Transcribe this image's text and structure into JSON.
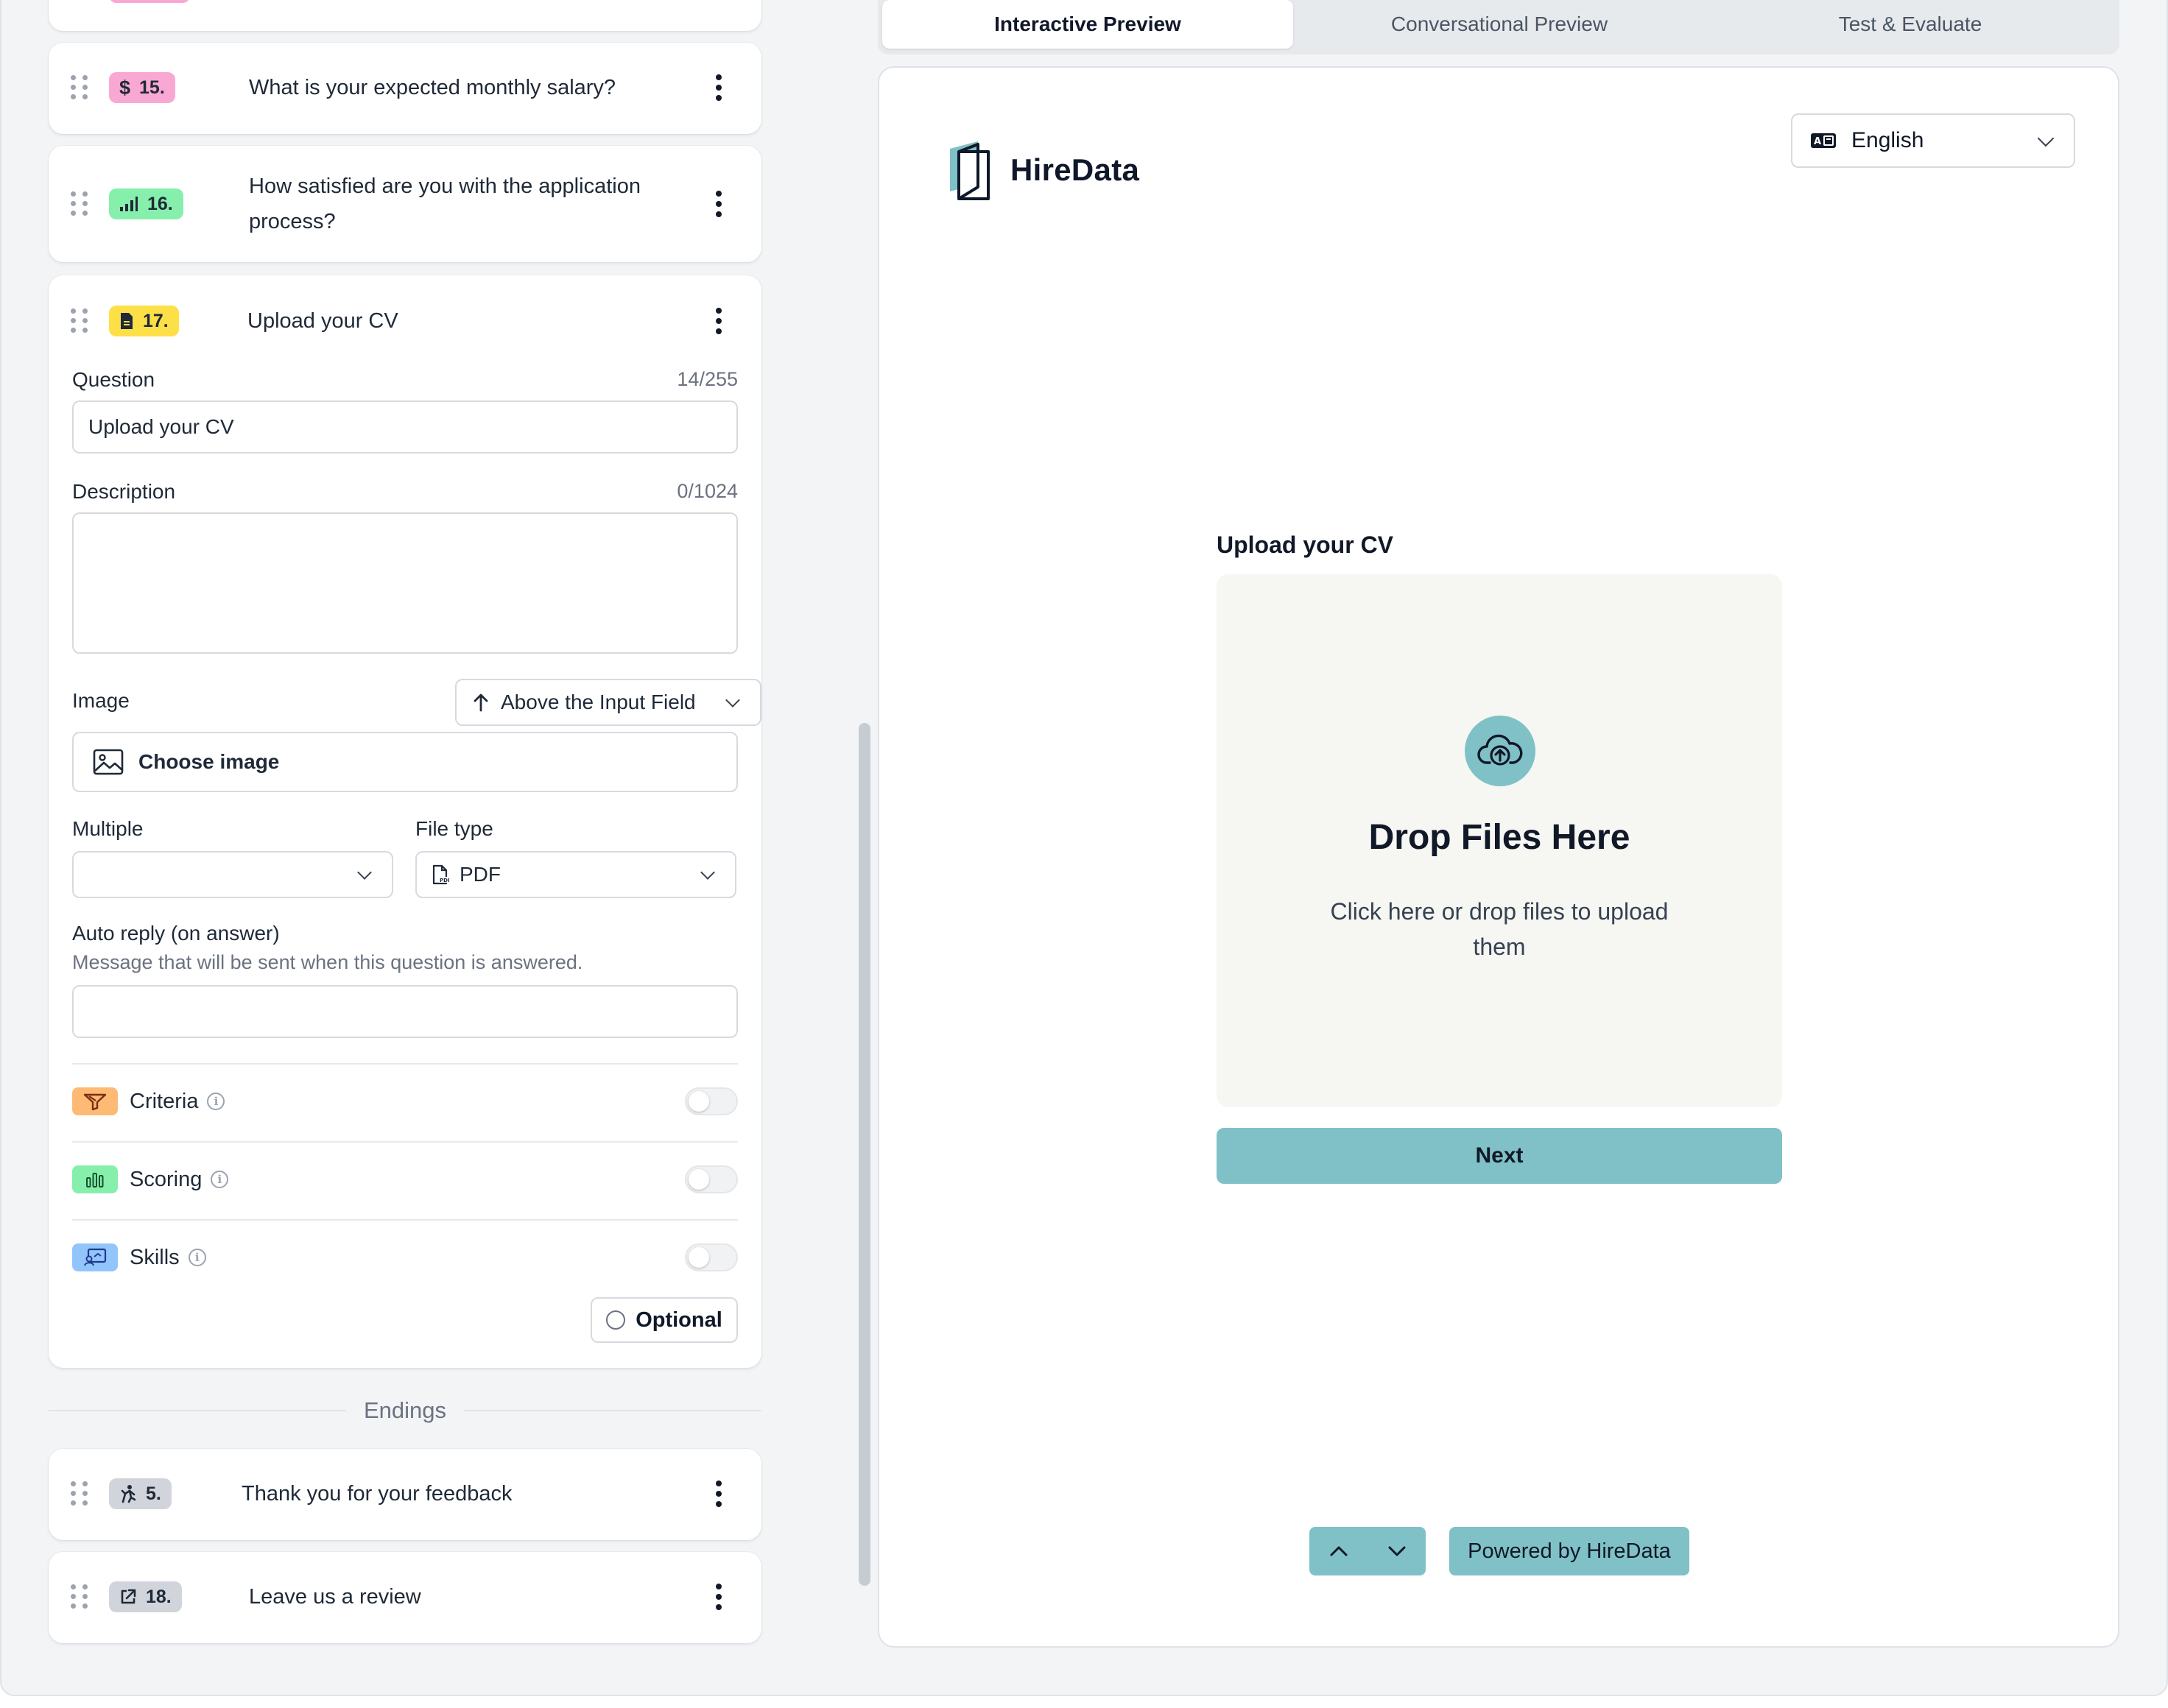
{
  "questions_above": [
    {
      "number": "15.",
      "text": "What is your expected monthly salary?",
      "badge_color": "#f9a8d4",
      "icon": "dollar-icon"
    },
    {
      "number": "16.",
      "text": "How satisfied are you with the application process?",
      "badge_color": "#86efac",
      "icon": "signal-bars-icon"
    }
  ],
  "active_question": {
    "number": "17.",
    "title": "Upload your CV",
    "badge_color": "#fde047",
    "icon": "file-icon",
    "question_label": "Question",
    "question_counter": "14/255",
    "question_value": "Upload your CV",
    "description_label": "Description",
    "description_counter": "0/1024",
    "description_value": "",
    "image_label": "Image",
    "image_position": "Above the Input Field",
    "choose_image_label": "Choose image",
    "multiple_label": "Multiple",
    "multiple_value": "",
    "file_type_label": "File type",
    "file_type_value": "PDF",
    "auto_reply_label": "Auto reply (on answer)",
    "auto_reply_help": "Message that will be sent when this question is answered.",
    "auto_reply_value": "",
    "toggles": [
      {
        "label": "Criteria",
        "icon": "filter-icon",
        "color": "#fdba74",
        "on": false
      },
      {
        "label": "Scoring",
        "icon": "bar-chart-icon",
        "color": "#86efac",
        "on": false
      },
      {
        "label": "Skills",
        "icon": "skills-icon",
        "color": "#93c5fd",
        "on": false
      }
    ],
    "optional_label": "Optional"
  },
  "endings_label": "Endings",
  "endings": [
    {
      "number": "5.",
      "text": "Thank you for your feedback",
      "icon": "celebrate-icon"
    },
    {
      "number": "18.",
      "text": "Leave us a review",
      "icon": "external-link-icon"
    }
  ],
  "tabs": [
    {
      "label": "Interactive Preview",
      "active": true
    },
    {
      "label": "Conversational Preview",
      "active": false
    },
    {
      "label": "Test & Evaluate",
      "active": false
    }
  ],
  "preview": {
    "brand": "HireData",
    "language": "English",
    "question_title": "Upload your CV",
    "drop_title": "Drop Files Here",
    "drop_subtitle": "Click here or drop files to upload them",
    "next_label": "Next",
    "powered_by": "Powered by HireData",
    "accent_color": "#7fc1c7"
  }
}
